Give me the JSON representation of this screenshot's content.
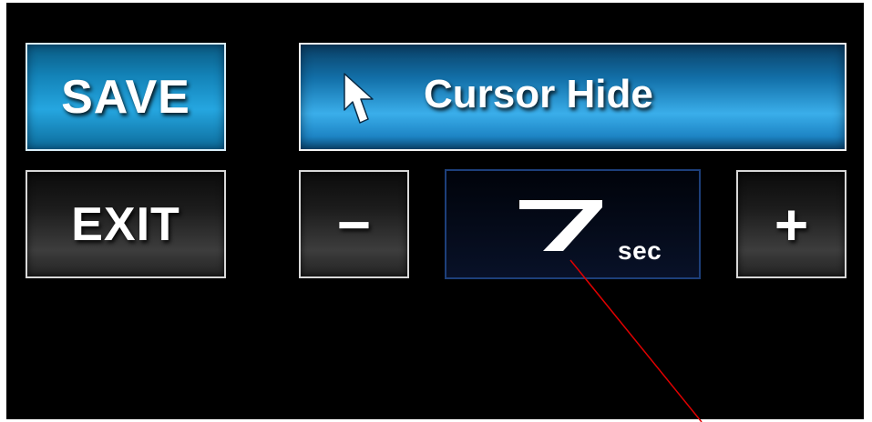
{
  "buttons": {
    "save_label": "SAVE",
    "exit_label": "EXIT",
    "minus_label": "−",
    "plus_label": "+"
  },
  "setting": {
    "title": "Cursor Hide",
    "icon": "cursor-arrow-icon",
    "value": "7",
    "unit": "sec"
  },
  "colors": {
    "panel_background": "#000000",
    "blue_accent": "#25a6e0",
    "pointer_line": "#e00000"
  }
}
